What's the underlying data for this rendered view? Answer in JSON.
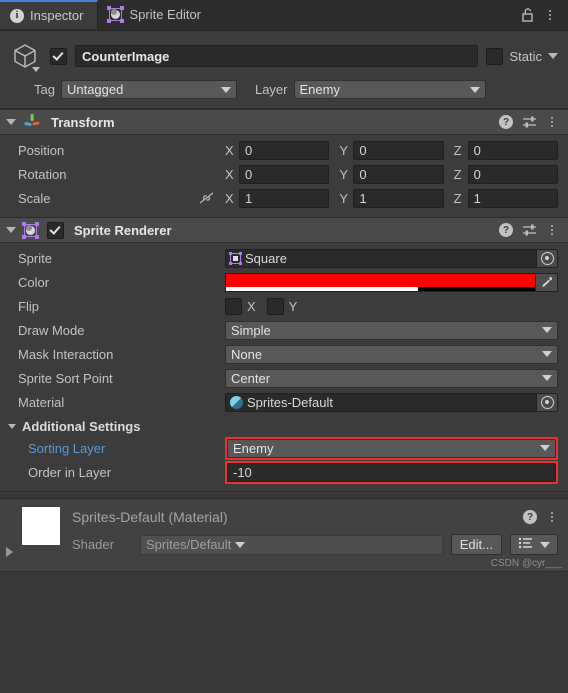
{
  "window": {
    "tabs": [
      {
        "label": "Inspector",
        "icon": "info-icon",
        "active": true
      },
      {
        "label": "Sprite Editor",
        "icon": "sprite-editor-icon",
        "active": false
      }
    ],
    "lock_icon": "lock-open-icon",
    "menu_icon": "kebab-menu-icon"
  },
  "gameobject": {
    "icon": "cube-icon",
    "enabled": true,
    "name": "CounterImage",
    "static_label": "Static",
    "static_checked": false,
    "tag_label": "Tag",
    "tag_value": "Untagged",
    "layer_label": "Layer",
    "layer_value": "Enemy"
  },
  "transform": {
    "title": "Transform",
    "icon": "transform-axis-icon",
    "help_icon": "help-icon",
    "preset_icon": "preset-settings-icon",
    "menu_icon": "kebab-menu-icon",
    "rows": [
      {
        "label": "Position",
        "x": "0",
        "y": "0",
        "z": "0"
      },
      {
        "label": "Rotation",
        "x": "0",
        "y": "0",
        "z": "0"
      },
      {
        "label": "Scale",
        "x": "1",
        "y": "1",
        "z": "1",
        "link_icon": "broken-link-icon"
      }
    ],
    "axis_labels": {
      "x": "X",
      "y": "Y",
      "z": "Z"
    }
  },
  "sprite_renderer": {
    "title": "Sprite Renderer",
    "icon": "sprite-renderer-icon",
    "enabled": true,
    "help_icon": "help-icon",
    "preset_icon": "preset-settings-icon",
    "menu_icon": "kebab-menu-icon",
    "sprite": {
      "label": "Sprite",
      "value": "Square",
      "icon": "sprite-asset-icon",
      "picker_icon": "object-picker-icon"
    },
    "color": {
      "label": "Color",
      "hex": "#ff0000",
      "alpha_percent": 62,
      "eyedropper_icon": "eyedropper-icon"
    },
    "flip": {
      "label": "Flip",
      "x_label": "X",
      "y_label": "Y",
      "x_checked": false,
      "y_checked": false
    },
    "draw_mode": {
      "label": "Draw Mode",
      "value": "Simple"
    },
    "mask_interaction": {
      "label": "Mask Interaction",
      "value": "None"
    },
    "sprite_sort_point": {
      "label": "Sprite Sort Point",
      "value": "Center"
    },
    "material": {
      "label": "Material",
      "value": "Sprites-Default",
      "icon": "material-icon",
      "picker_icon": "object-picker-icon"
    },
    "additional_settings": {
      "title": "Additional Settings",
      "sorting_layer": {
        "label": "Sorting Layer",
        "value": "Enemy",
        "highlighted": true
      },
      "order_in_layer": {
        "label": "Order in Layer",
        "value": "-10",
        "highlighted": true
      }
    }
  },
  "material_preview": {
    "title": "Sprites-Default (Material)",
    "help_icon": "help-icon",
    "menu_icon": "kebab-menu-icon",
    "expand_icon": "triangle-right-icon",
    "shader_label": "Shader",
    "shader_value": "Sprites/Default",
    "edit_button": "Edit...",
    "list_dropdown_icon": "list-view-icon",
    "watermark": "CSDN @cyr___"
  },
  "colors": {
    "accent": "#4b7fd1",
    "highlight": "#f03030",
    "link": "#5a9bd8",
    "panel": "#3c3c3c",
    "header": "#4a4a4a"
  }
}
